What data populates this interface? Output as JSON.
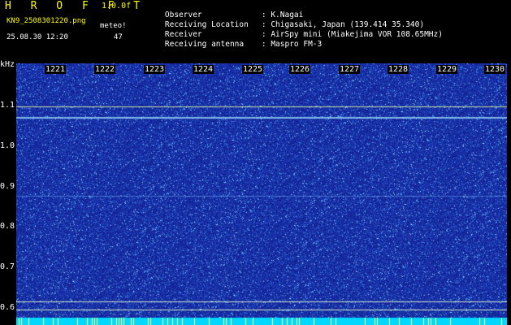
{
  "header": {
    "app_name": "H R O F F T",
    "version": "1.0.0f",
    "file_name": "KN9_2508301220.png",
    "meteo_label": "meteo!",
    "datetime": "25.08.30 12:20",
    "count": "47"
  },
  "info": {
    "rows": [
      {
        "key": "Observer",
        "value": ": K.Nagai"
      },
      {
        "key": "Receiving Location",
        "value": ": Chigasaki, Japan (139.414 35.340)"
      },
      {
        "key": "Receiver",
        "value": ": AirSpy mini (Miakejima VOR 108.65MHz)"
      },
      {
        "key": "Receiving antenna",
        "value": ": Maspro FM-3"
      }
    ]
  },
  "axes": {
    "y_unit": "kHz",
    "x_ticks": [
      "1221",
      "1222",
      "1223",
      "1224",
      "1225",
      "1226",
      "1227",
      "1228",
      "1229",
      "1230"
    ],
    "y_ticks": [
      "1.1",
      "1.0",
      "0.9",
      "0.8",
      "0.7",
      "0.6"
    ]
  },
  "colors": {
    "background": "#000000",
    "header_accent": "#ffff00",
    "plot_base": "#1a2a9a",
    "noise_speckle": "#5aa0ff",
    "carrier_line": "#e0ffa0",
    "bottom_band": "#00d8ff"
  }
}
